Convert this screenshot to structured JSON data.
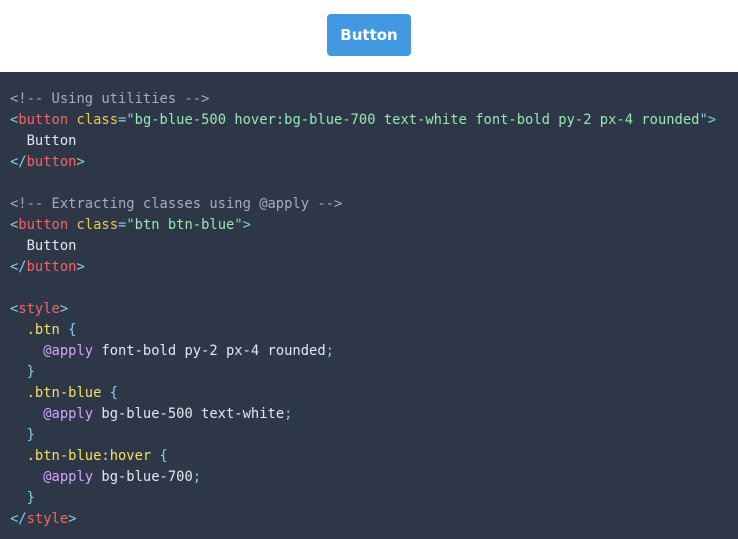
{
  "preview": {
    "button_label": "Button"
  },
  "colors": {
    "button_bg": "#4299e1",
    "code_bg": "#2d3748"
  },
  "code_lines": [
    [
      {
        "t": "<!-- Using utilities -->",
        "c": "comment"
      }
    ],
    [
      {
        "t": "<",
        "c": "punct"
      },
      {
        "t": "button",
        "c": "tag"
      },
      {
        "t": " ",
        "c": "text"
      },
      {
        "t": "class",
        "c": "attr"
      },
      {
        "t": "=",
        "c": "punct"
      },
      {
        "t": "\"",
        "c": "punct"
      },
      {
        "t": "bg-blue-500 hover:bg-blue-700 text-white font-bold py-2 px-4 rounded",
        "c": "string"
      },
      {
        "t": "\"",
        "c": "punct"
      },
      {
        "t": ">",
        "c": "punct"
      }
    ],
    [
      {
        "t": "  Button",
        "c": "text"
      }
    ],
    [
      {
        "t": "</",
        "c": "punct"
      },
      {
        "t": "button",
        "c": "tag"
      },
      {
        "t": ">",
        "c": "punct"
      }
    ],
    [],
    [
      {
        "t": "<!-- Extracting classes using @apply -->",
        "c": "comment"
      }
    ],
    [
      {
        "t": "<",
        "c": "punct"
      },
      {
        "t": "button",
        "c": "tag"
      },
      {
        "t": " ",
        "c": "text"
      },
      {
        "t": "class",
        "c": "attr"
      },
      {
        "t": "=",
        "c": "punct"
      },
      {
        "t": "\"",
        "c": "punct"
      },
      {
        "t": "btn btn-blue",
        "c": "string"
      },
      {
        "t": "\"",
        "c": "punct"
      },
      {
        "t": ">",
        "c": "punct"
      }
    ],
    [
      {
        "t": "  Button",
        "c": "text"
      }
    ],
    [
      {
        "t": "</",
        "c": "punct"
      },
      {
        "t": "button",
        "c": "tag"
      },
      {
        "t": ">",
        "c": "punct"
      }
    ],
    [],
    [
      {
        "t": "<",
        "c": "punct"
      },
      {
        "t": "style",
        "c": "tag"
      },
      {
        "t": ">",
        "c": "punct"
      }
    ],
    [
      {
        "t": "  ",
        "c": "text"
      },
      {
        "t": ".btn",
        "c": "selector"
      },
      {
        "t": " {",
        "c": "punct"
      }
    ],
    [
      {
        "t": "    ",
        "c": "text"
      },
      {
        "t": "@apply",
        "c": "at"
      },
      {
        "t": " font-bold py-2 px-4 rounded",
        "c": "text"
      },
      {
        "t": ";",
        "c": "punct"
      }
    ],
    [
      {
        "t": "  }",
        "c": "punct"
      }
    ],
    [
      {
        "t": "  ",
        "c": "text"
      },
      {
        "t": ".btn-blue",
        "c": "selector"
      },
      {
        "t": " {",
        "c": "punct"
      }
    ],
    [
      {
        "t": "    ",
        "c": "text"
      },
      {
        "t": "@apply",
        "c": "at"
      },
      {
        "t": " bg-blue-500 text-white",
        "c": "text"
      },
      {
        "t": ";",
        "c": "punct"
      }
    ],
    [
      {
        "t": "  }",
        "c": "punct"
      }
    ],
    [
      {
        "t": "  ",
        "c": "text"
      },
      {
        "t": ".btn-blue:hover",
        "c": "selector"
      },
      {
        "t": " {",
        "c": "punct"
      }
    ],
    [
      {
        "t": "    ",
        "c": "text"
      },
      {
        "t": "@apply",
        "c": "at"
      },
      {
        "t": " bg-blue-700",
        "c": "text"
      },
      {
        "t": ";",
        "c": "punct"
      }
    ],
    [
      {
        "t": "  }",
        "c": "punct"
      }
    ],
    [
      {
        "t": "</",
        "c": "punct"
      },
      {
        "t": "style",
        "c": "tag"
      },
      {
        "t": ">",
        "c": "punct"
      }
    ]
  ]
}
